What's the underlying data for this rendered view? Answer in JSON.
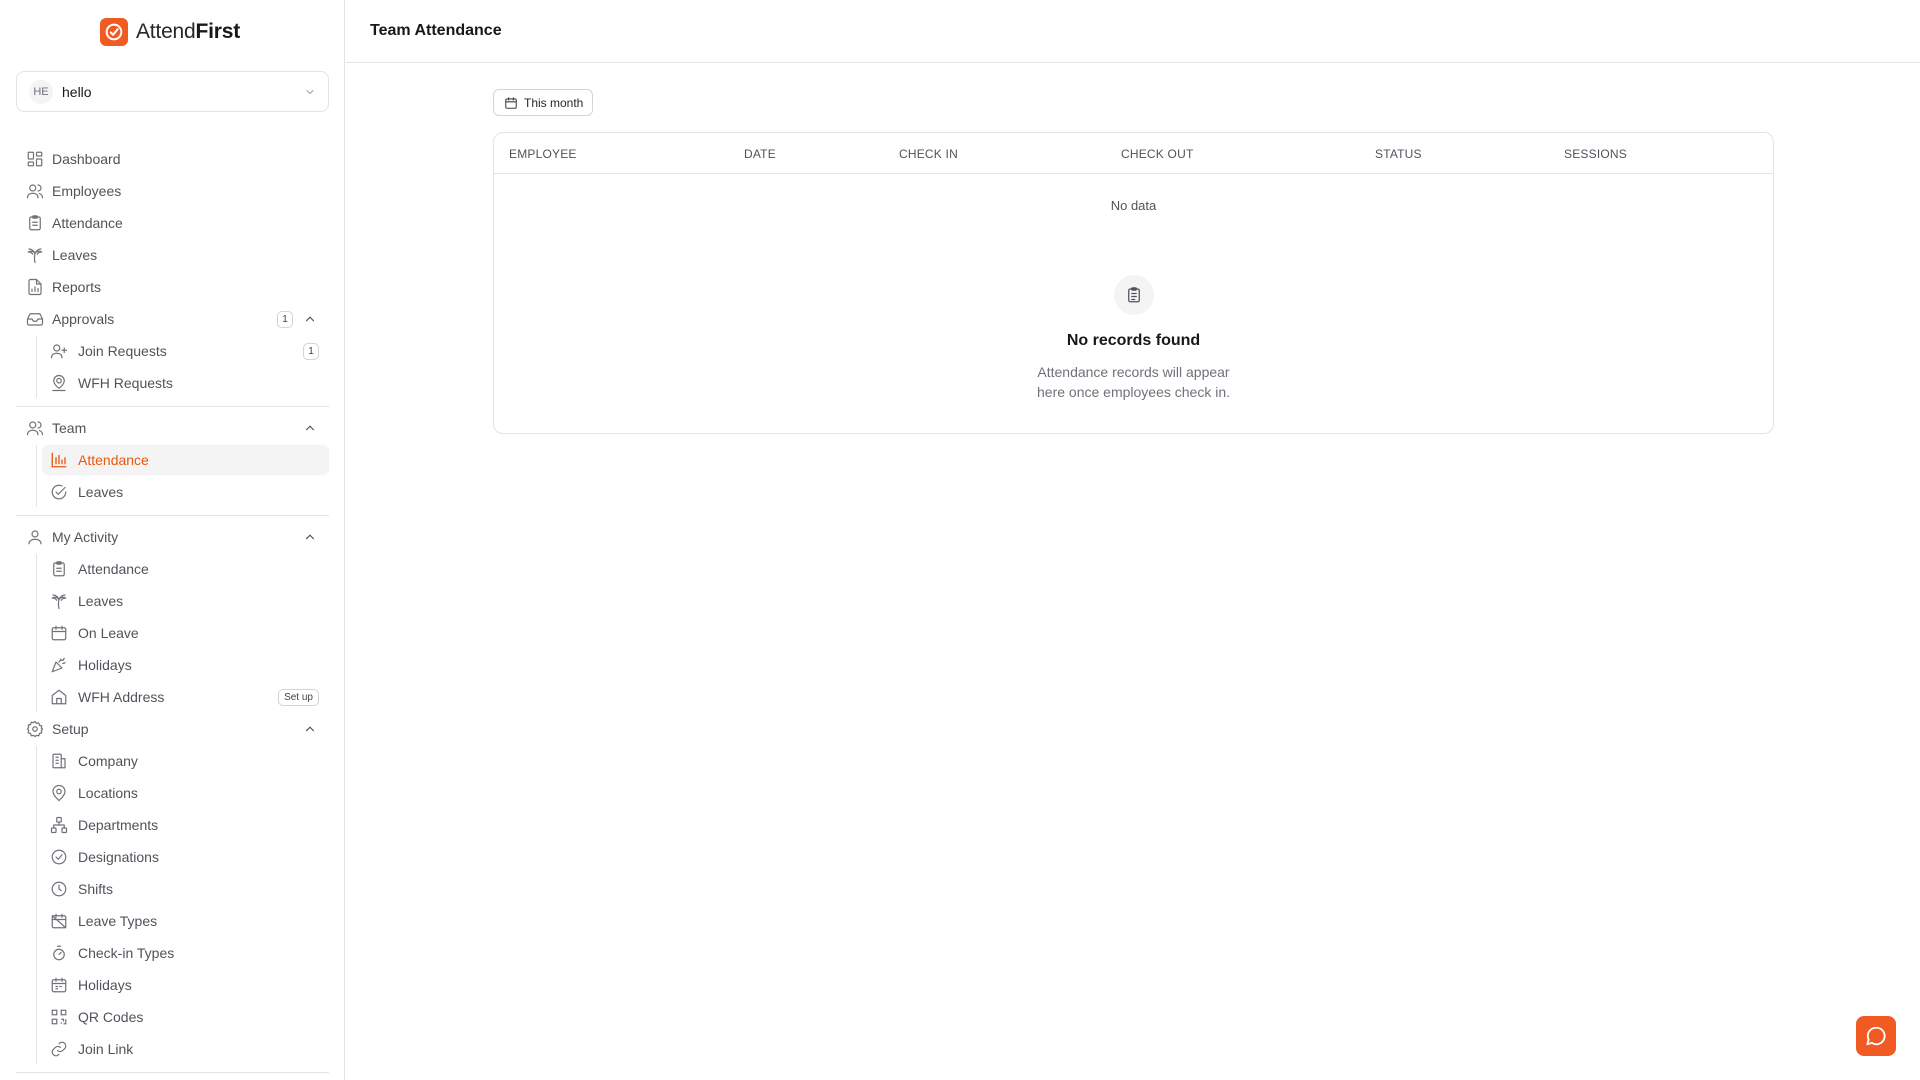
{
  "brand": {
    "name_part1": "Attend",
    "name_part2": "First",
    "accent": "#f15a22"
  },
  "workspace": {
    "initials": "HE",
    "name": "hello"
  },
  "nav": {
    "dashboard": "Dashboard",
    "employees": "Employees",
    "attendance": "Attendance",
    "leaves": "Leaves",
    "reports": "Reports",
    "approvals": {
      "label": "Approvals",
      "badge": "1",
      "items": {
        "join_requests": {
          "label": "Join Requests",
          "badge": "1"
        },
        "wfh_requests": {
          "label": "WFH Requests"
        }
      }
    },
    "team": {
      "label": "Team",
      "items": {
        "attendance": {
          "label": "Attendance"
        },
        "leaves": {
          "label": "Leaves"
        }
      }
    },
    "my_activity": {
      "label": "My Activity",
      "items": {
        "attendance": {
          "label": "Attendance"
        },
        "leaves": {
          "label": "Leaves"
        },
        "on_leave": {
          "label": "On Leave"
        },
        "holidays": {
          "label": "Holidays"
        },
        "wfh_address": {
          "label": "WFH Address",
          "badge": "Set up"
        }
      }
    },
    "setup": {
      "label": "Setup",
      "items": {
        "company": {
          "label": "Company"
        },
        "locations": {
          "label": "Locations"
        },
        "departments": {
          "label": "Departments"
        },
        "designations": {
          "label": "Designations"
        },
        "shifts": {
          "label": "Shifts"
        },
        "leave_types": {
          "label": "Leave Types"
        },
        "checkin_types": {
          "label": "Check-in Types"
        },
        "holidays": {
          "label": "Holidays"
        },
        "qr_codes": {
          "label": "QR Codes"
        },
        "join_link": {
          "label": "Join Link"
        }
      }
    }
  },
  "header": {
    "title": "Team Attendance"
  },
  "filter": {
    "period": "This month"
  },
  "table": {
    "columns": {
      "employee": "EMPLOYEE",
      "date": "DATE",
      "check_in": "CHECK IN",
      "check_out": "CHECK OUT",
      "status": "STATUS",
      "sessions": "SESSIONS"
    },
    "no_data": "No data",
    "empty_title": "No records found",
    "empty_desc_line1": "Attendance records will appear",
    "empty_desc_line2": "here once employees check in."
  },
  "icons": [
    "logo-check-icon",
    "chevron-down-icon",
    "grid-icon",
    "users-icon",
    "clipboard-icon",
    "palm-tree-icon",
    "file-chart-icon",
    "inbox-icon",
    "user-plus-icon",
    "map-pin-user-icon",
    "bar-chart-icon",
    "check-circle-icon",
    "user-icon",
    "calendar-icon",
    "party-popper-icon",
    "home-icon",
    "gear-icon",
    "building-icon",
    "map-pin-icon",
    "network-icon",
    "clock-icon",
    "calendar-off-icon",
    "timer-icon",
    "qr-code-icon",
    "link-icon",
    "chat-icon",
    "chevron-up-icon"
  ]
}
